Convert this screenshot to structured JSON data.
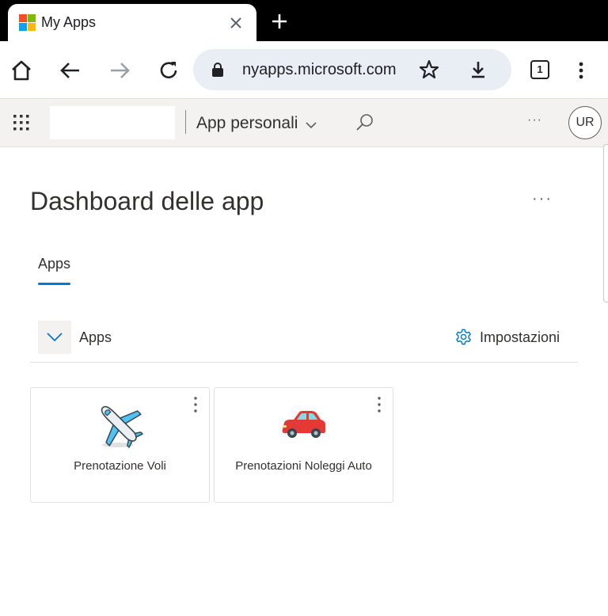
{
  "browser": {
    "tab": {
      "title": "My Apps",
      "favicon": "microsoft-logo-icon",
      "close_icon": "close-icon"
    },
    "new_tab_icon": "plus-icon",
    "toolbar": {
      "home_icon": "home-icon",
      "back_icon": "arrow-left-icon",
      "forward_icon": "arrow-right-icon",
      "reload_icon": "reload-icon",
      "url": "nyapps.microsoft.com",
      "lock_icon": "lock-icon",
      "bookmark_icon": "star-icon",
      "download_icon": "download-icon",
      "tab_count": "1",
      "menu_icon": "kebab-icon"
    }
  },
  "app_header": {
    "waffle_icon": "waffle-icon",
    "title": "App personali",
    "chevron_icon": "chevron-down-icon",
    "search_icon": "search-icon",
    "more": "···",
    "avatar_initials": "UR"
  },
  "dashboard": {
    "title": "Dashboard delle app",
    "more": "···",
    "tabs": [
      {
        "label": "Apps",
        "active": true
      }
    ],
    "section": {
      "label": "Apps",
      "collapse_icon": "chevron-down-icon",
      "settings_label": "Impostazioni",
      "settings_icon": "gear-icon"
    },
    "apps": [
      {
        "label": "Prenotazione Voli",
        "icon": "airplane-icon"
      },
      {
        "label": "Prenotazioni Noleggi Auto",
        "icon": "car-icon"
      }
    ]
  },
  "colors": {
    "accent": "#0078d4",
    "ms_red": "#f25022",
    "ms_green": "#7fba00",
    "ms_blue": "#00a4ef",
    "ms_yellow": "#ffb900",
    "car_red": "#e53935",
    "plane_blue": "#4fc3f7"
  }
}
